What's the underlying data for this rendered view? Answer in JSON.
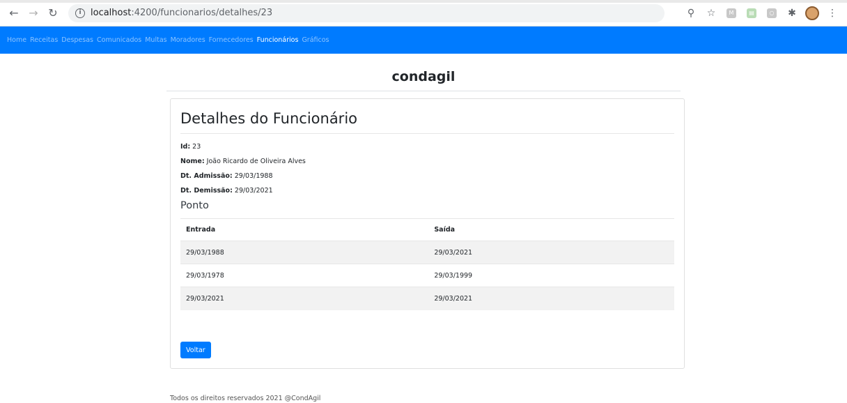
{
  "browser": {
    "url_host": "localhost",
    "url_path": ":4200/funcionarios/detalhes/23",
    "icons": [
      "back-icon",
      "forward-icon",
      "reload-icon",
      "info-icon",
      "zoom-icon",
      "star-icon",
      "extension-icon",
      "puzzle-icon",
      "avatar",
      "menu-icon"
    ]
  },
  "nav": {
    "items": [
      {
        "label": "Home"
      },
      {
        "label": "Receitas"
      },
      {
        "label": "Despesas"
      },
      {
        "label": "Comunicados"
      },
      {
        "label": "Multas"
      },
      {
        "label": "Moradores"
      },
      {
        "label": "Fornecedores"
      },
      {
        "label": "Funcionários"
      },
      {
        "label": "Gráficos"
      }
    ],
    "active": "Funcionários",
    "color": "#007bff"
  },
  "brand": "condagil",
  "card": {
    "title": "Detalhes do Funcionário",
    "fields": [
      {
        "label": "Id:",
        "value": "23"
      },
      {
        "label": "Nome:",
        "value": "João Ricardo de Oliveira Alves"
      },
      {
        "label": "Dt. Admissão:",
        "value": "29/03/1988"
      },
      {
        "label": "Dt. Demissão:",
        "value": "29/03/2021"
      }
    ],
    "section_title": "Ponto",
    "table": {
      "headers": [
        "Entrada",
        "Saída"
      ],
      "rows": [
        [
          "29/03/1988",
          "29/03/2021"
        ],
        [
          "29/03/1978",
          "29/03/1999"
        ],
        [
          "29/03/2021",
          "29/03/2021"
        ]
      ]
    },
    "back_button": "Voltar"
  },
  "footer": "Todos os direitos reservados 2021 @CondAgil"
}
